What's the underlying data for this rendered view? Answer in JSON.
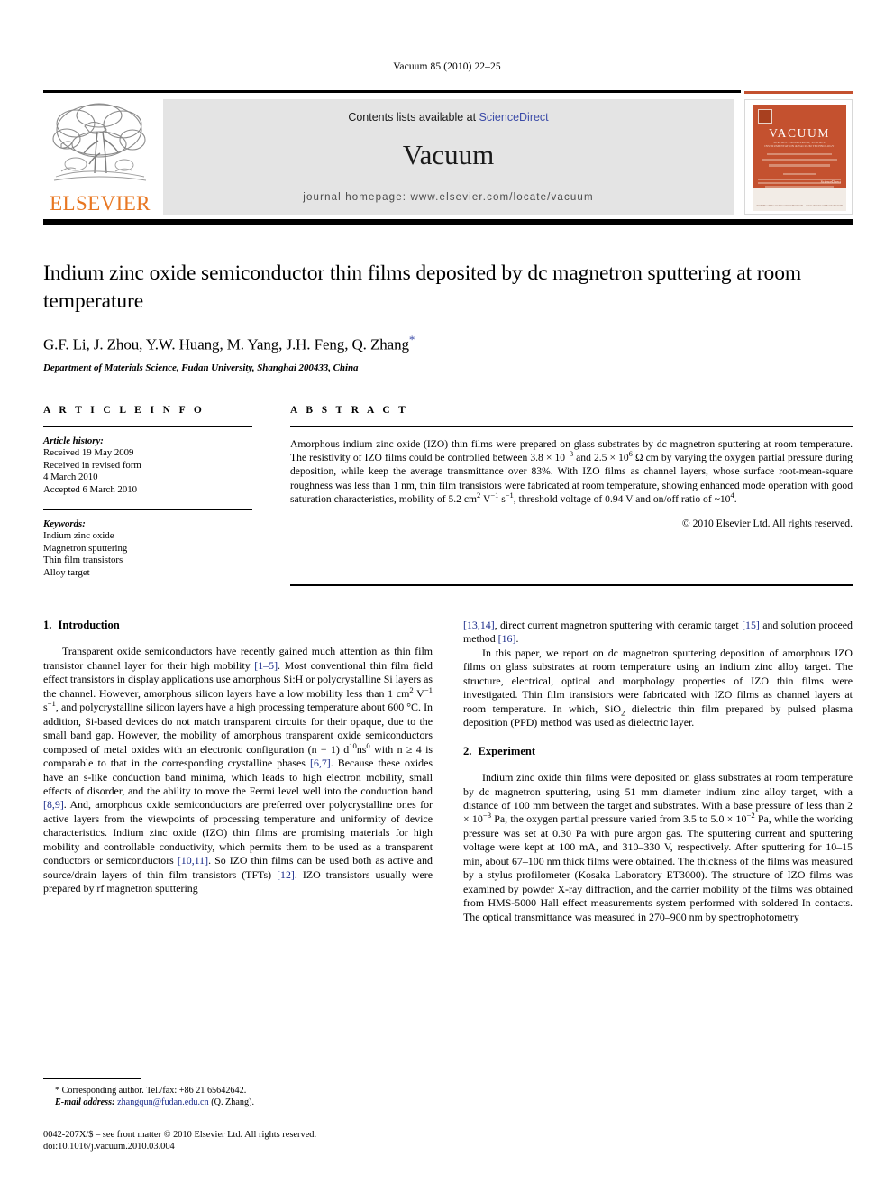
{
  "running_head": "Vacuum 85 (2010) 22–25",
  "masthead": {
    "contents_prefix": "Contents lists available at ",
    "sciencedirect": "ScienceDirect",
    "journal_title": "Vacuum",
    "homepage": "journal homepage: www.elsevier.com/locate/vacuum",
    "publisher_wordmark": "ELSEVIER",
    "publisher_logo_icon": "elsevier-tree-icon",
    "cover": {
      "title": "VACUUM",
      "subtitle": "SURFACE ENGINEERING, SURFACE INSTRUMENTATION\n& VACUUM TECHNOLOGY",
      "sciencedirect": "ScienceDirect",
      "footer_left": "Available online at www.sciencedirect.com",
      "footer_right": "www.elsevier.com/locate/vacuum"
    },
    "accent_color": "#c4512f",
    "link_color": "#3b4ba8"
  },
  "article": {
    "title": "Indium zinc oxide semiconductor thin films deposited by dc magnetron sputtering at room temperature",
    "authors": "G.F. Li, J. Zhou, Y.W. Huang, M. Yang, J.H. Feng, Q. Zhang",
    "corresponding_marker": "*",
    "affiliation": "Department of Materials Science, Fudan University, Shanghai 200433, China"
  },
  "article_info": {
    "label": "A R T I C L E   I N F O",
    "history_label": "Article history:",
    "history": [
      "Received 19 May 2009",
      "Received in revised form",
      "4 March 2010",
      "Accepted 6 March 2010"
    ],
    "keywords_label": "Keywords:",
    "keywords": [
      "Indium zinc oxide",
      "Magnetron sputtering",
      "Thin film transistors",
      "Alloy target"
    ]
  },
  "abstract": {
    "label": "A B S T R A C T",
    "p1_a": "Amorphous indium zinc oxide (IZO) thin films were prepared on glass substrates by dc magnetron sputtering at room temperature. The resistivity of IZO films could be controlled between 3.8 × 10",
    "p1_exp1": "−3",
    "p1_b": " and 2.5 × 10",
    "p1_exp2": "6",
    "p1_c": " Ω cm by varying the oxygen partial pressure during deposition, while keep the average transmittance over 83%. With IZO films as channel layers, whose surface root-mean-square roughness was less than 1 nm, thin film transistors were fabricated at room temperature, showing enhanced mode operation with good saturation characteristics, mobility of 5.2 cm",
    "p1_exp3": "2",
    "p1_d": " V",
    "p1_exp4": "−1",
    "p1_e": " s",
    "p1_exp5": "−1",
    "p1_f": ", threshold voltage of 0.94 V and on/off ratio of ~10",
    "p1_exp6": "4",
    "p1_g": ".",
    "copyright": "© 2010 Elsevier Ltd. All rights reserved."
  },
  "body": {
    "intro_heading_num": "1.",
    "intro_heading_text": "Introduction",
    "intro_p1_a": "Transparent oxide semiconductors have recently gained much attention as thin film transistor channel layer for their high mobility ",
    "intro_p1_ref1": "[1–5]",
    "intro_p1_b": ". Most conventional thin film field effect transistors in display applications use amorphous Si:H or polycrystalline Si layers as the channel. However, amorphous silicon layers have a low mobility less than 1 cm",
    "intro_p1_sup1": "2",
    "intro_p1_c": " V",
    "intro_p1_sup2": "−1",
    "intro_p1_d": " s",
    "intro_p1_sup3": "−1",
    "intro_p1_e": ", and polycrystalline silicon layers have a high processing temperature about 600 °C. In addition, Si-based devices do not match transparent circuits for their opaque, due to the small band gap. However, the mobility of amorphous transparent oxide semiconductors composed of metal oxides with an electronic configuration (n − 1) d",
    "intro_p1_sup4": "10",
    "intro_p1_f": "ns",
    "intro_p1_sup5": "0",
    "intro_p1_g": " with n ≥ 4 is comparable to that in the corresponding crystalline phases ",
    "intro_p1_ref2": "[6,7]",
    "intro_p1_h": ". Because these oxides have an s-like conduction band minima, which leads to high electron mobility, small effects of disorder, and the ability to move the Fermi level well into the conduction band ",
    "intro_p1_ref3": "[8,9]",
    "intro_p1_i": ". And, amorphous oxide semiconductors are preferred over polycrystalline ones for active layers from the viewpoints of processing temperature and uniformity of device characteristics. Indium zinc oxide (IZO) thin films are promising materials for high mobility and controllable conductivity, which permits them to be used as a transparent conductors or semiconductors ",
    "intro_p1_ref4": "[10,11]",
    "intro_p1_j": ". So IZO thin films can be used both as active and source/drain layers of thin film transistors (TFTs) ",
    "intro_p1_ref5": "[12]",
    "intro_p1_k": ". IZO transistors usually were prepared by rf magnetron sputtering ",
    "intro_p1_ref6": "[13,14]",
    "intro_p1_l": ", direct current magnetron sputtering with ceramic target ",
    "intro_p1_ref7": "[15]",
    "intro_p1_m": " and solution proceed method ",
    "intro_p1_ref8": "[16]",
    "intro_p1_n": ".",
    "intro_p2_a": "In this paper, we report on dc magnetron sputtering deposition of amorphous IZO films on glass substrates at room temperature using an indium zinc alloy target. The structure, electrical, optical and morphology properties of IZO thin films were investigated. Thin film transistors were fabricated with IZO films as channel layers at room temperature. In which, SiO",
    "intro_p2_sub1": "2",
    "intro_p2_b": " dielectric thin film prepared by pulsed plasma deposition (PPD) method was used as dielectric layer.",
    "exp_heading_num": "2.",
    "exp_heading_text": "Experiment",
    "exp_p1_a": "Indium zinc oxide thin films were deposited on glass substrates at room temperature by dc magnetron sputtering, using 51 mm diameter indium zinc alloy target, with a distance of 100 mm between the target and substrates. With a base pressure of less than 2 × 10",
    "exp_p1_sup1": "−3",
    "exp_p1_b": " Pa, the oxygen partial pressure varied from 3.5 to 5.0 × 10",
    "exp_p1_sup2": "−2",
    "exp_p1_c": " Pa, while the working pressure was set at 0.30 Pa with pure argon gas. The sputtering current and sputtering voltage were kept at 100 mA, and 310–330 V, respectively. After sputtering for 10–15 min, about 67–100 nm thick films were obtained. The thickness of the films was measured by a stylus profilometer (Kosaka Laboratory ET3000). The structure of IZO films was examined by powder X-ray diffraction, and the carrier mobility of the films was obtained from HMS-5000 Hall effect measurements system performed with soldered In contacts. The optical transmittance was measured in 270–900 nm by spectrophotometry"
  },
  "footnote": {
    "corresponding": "* Corresponding author. Tel./fax: +86 21 65642642.",
    "email_label": "E-mail address:",
    "email": "zhangqun@fudan.edu.cn",
    "email_suffix": "(Q. Zhang)."
  },
  "imprint": {
    "line1": "0042-207X/$ – see front matter © 2010 Elsevier Ltd. All rights reserved.",
    "line2": "doi:10.1016/j.vacuum.2010.03.004"
  }
}
